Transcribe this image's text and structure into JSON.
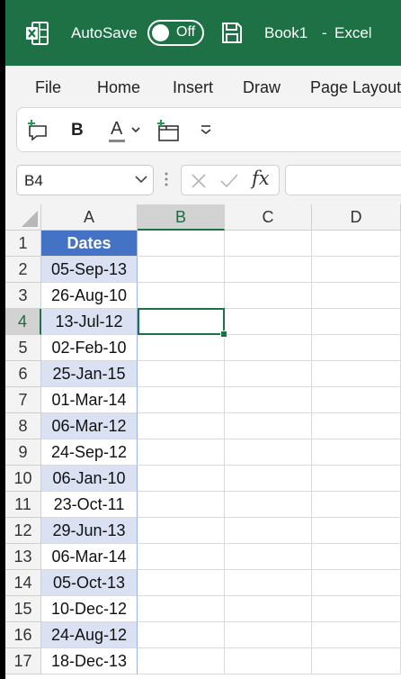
{
  "titlebar": {
    "autosave_label": "AutoSave",
    "toggle_state": "Off",
    "book_name": "Book1",
    "separator": "-",
    "app_name": "Excel",
    "color": "#1e7145"
  },
  "menu": {
    "items": [
      "File",
      "Home",
      "Insert",
      "Draw",
      "Page Layout"
    ]
  },
  "ribbon": {
    "icons": [
      "new-comment-icon",
      "bold-icon",
      "font-color-icon",
      "insert-table-icon",
      "customize-toolbar-icon"
    ],
    "bold_label": "B",
    "font_color_label": "A"
  },
  "formula_bar": {
    "name_box": "B4",
    "fx_label": "fx",
    "value": ""
  },
  "grid": {
    "columns": [
      "A",
      "B",
      "C",
      "D"
    ],
    "selected_column": "B",
    "rows": [
      "1",
      "2",
      "3",
      "4",
      "5",
      "6",
      "7",
      "8",
      "9",
      "10",
      "11",
      "12",
      "13",
      "14",
      "15",
      "16",
      "17"
    ],
    "selected_row": "4",
    "header_label": "Dates",
    "dates": [
      {
        "value": "05-Sep-13",
        "highlighted": true
      },
      {
        "value": "26-Aug-10",
        "highlighted": false
      },
      {
        "value": "13-Jul-12",
        "highlighted": true
      },
      {
        "value": "02-Feb-10",
        "highlighted": false
      },
      {
        "value": "25-Jan-15",
        "highlighted": true
      },
      {
        "value": "01-Mar-14",
        "highlighted": false
      },
      {
        "value": "06-Mar-12",
        "highlighted": true
      },
      {
        "value": "24-Sep-12",
        "highlighted": false
      },
      {
        "value": "06-Jan-10",
        "highlighted": true
      },
      {
        "value": "23-Oct-11",
        "highlighted": false
      },
      {
        "value": "29-Jun-13",
        "highlighted": true
      },
      {
        "value": "06-Mar-14",
        "highlighted": false
      },
      {
        "value": "05-Oct-13",
        "highlighted": true
      },
      {
        "value": "10-Dec-12",
        "highlighted": false
      },
      {
        "value": "24-Aug-12",
        "highlighted": true
      },
      {
        "value": "18-Dec-13",
        "highlighted": false
      }
    ],
    "highlight_color": "#d9e1f2",
    "header_color": "#4472c4"
  }
}
